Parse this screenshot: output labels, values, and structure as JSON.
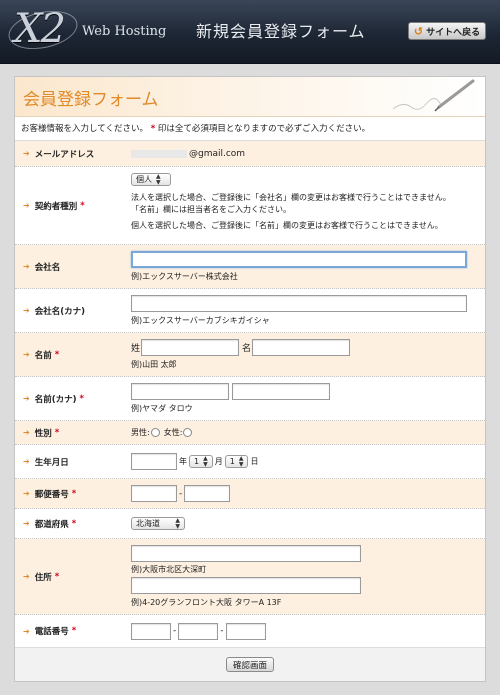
{
  "header": {
    "logo_mark": "X2",
    "logo_text": "Web Hosting",
    "title": "新規会員登録フォーム",
    "back_label": "サイトへ戻る"
  },
  "panel": {
    "title": "会員登録フォーム",
    "intro_pre": "お客様情報を入力してください。",
    "intro_mark": "*",
    "intro_post": "印は全て必須項目となりますので必ずご入力ください。"
  },
  "fields": {
    "email": {
      "label": "メールアドレス",
      "domain": "@gmail.com"
    },
    "contract": {
      "label": "契約者種別",
      "required": "*",
      "selected": "個人",
      "note1": "法人を選択した場合、ご登録後に「会社名」欄の変更はお客様で行うことはできません。",
      "note2": "「名前」欄には担当者名をご入力ください。",
      "note3": "個人を選択した場合、ご登録後に「名前」欄の変更はお客様で行うことはできません。"
    },
    "company": {
      "label": "会社名",
      "example": "例)エックスサーバー株式会社"
    },
    "company_kana": {
      "label": "会社名(カナ)",
      "example": "例)エックスサーバーカブシキガイシャ"
    },
    "name": {
      "label": "名前",
      "required": "*",
      "sei": "姓",
      "mei": "名",
      "example": "例)山田 太郎"
    },
    "name_kana": {
      "label": "名前(カナ)",
      "required": "*",
      "example": "例)ヤマダ タロウ"
    },
    "gender": {
      "label": "性別",
      "required": "*",
      "male": "男性:",
      "female": "女性:"
    },
    "birthday": {
      "label": "生年月日",
      "year_unit": "年",
      "month_value": "1",
      "month_unit": "月",
      "day_value": "1",
      "day_unit": "日"
    },
    "postal": {
      "label": "郵便番号",
      "required": "*",
      "dash": "-"
    },
    "prefecture": {
      "label": "都道府県",
      "required": "*",
      "selected": "北海道"
    },
    "address": {
      "label": "住所",
      "required": "*",
      "example1": "例)大阪市北区大深町",
      "example2": "例)4-20グランフロント大阪 タワーA 13F"
    },
    "phone": {
      "label": "電話番号",
      "required": "*",
      "dash": "-"
    }
  },
  "footer": {
    "confirm_label": "確認画面"
  },
  "colors": {
    "accent": "#e08a2a",
    "required": "#d0021b",
    "row_highlight": "#fdf0e0"
  }
}
